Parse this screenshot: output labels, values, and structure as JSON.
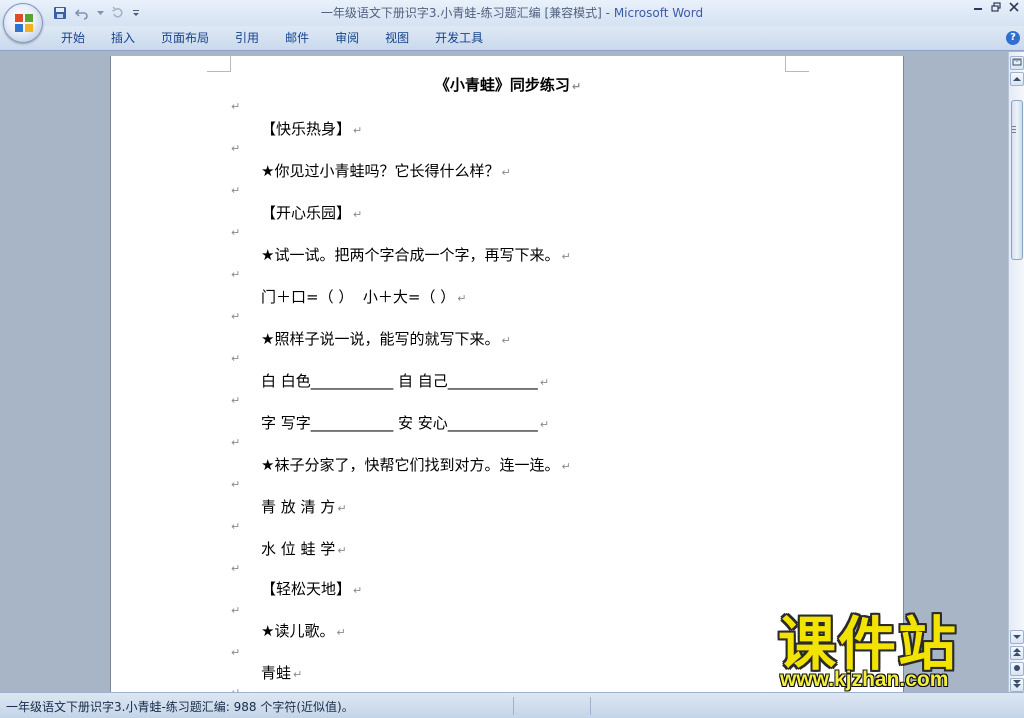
{
  "window": {
    "title": "一年级语文下册识字3.小青蛙-练习题汇编 [兼容模式]",
    "separator": " - ",
    "app_name": "Microsoft Word"
  },
  "ribbon": {
    "tabs": [
      "开始",
      "插入",
      "页面布局",
      "引用",
      "邮件",
      "审阅",
      "视图",
      "开发工具"
    ],
    "help_label": "?"
  },
  "document": {
    "title": "《小青蛙》同步练习",
    "lines": [
      "【快乐热身】",
      "★你见过小青蛙吗？它长得什么样？",
      "【开心乐园】",
      "★试一试。把两个字合成一个字，再写下来。",
      "门＋口=（ ）  小＋大=（ ）",
      "★照样子说一说，能写的就写下来。",
      "白 白色___________ 自 自己____________",
      "字 写字___________ 安 安心____________",
      "★袜子分家了，快帮它们找到对方。连一连。",
      "青 放 清 方",
      "水 位 蛙 学",
      "【轻松天地】",
      "★读儿歌。",
      "青蛙"
    ],
    "paragraph_mark": "↵"
  },
  "statusbar": {
    "text": "一年级语文下册识字3.小青蛙-练习题汇编: 988 个字符(近似值)。"
  },
  "watermark": {
    "main": "课件站",
    "url": "www.kjzhan.com"
  },
  "colors": {
    "ribbon_text": "#15428b",
    "app_name": "#3b5aa8",
    "watermark": "#f2e400"
  }
}
